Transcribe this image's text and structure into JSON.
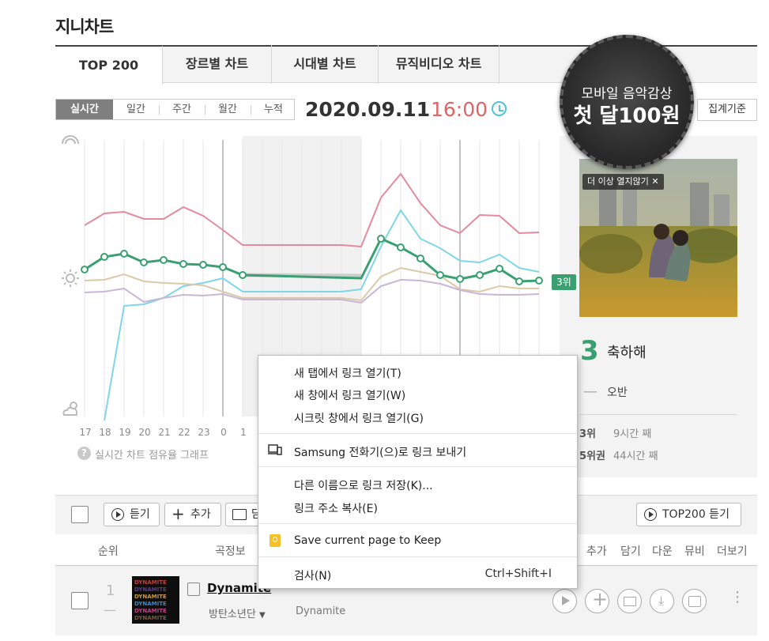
{
  "page": {
    "title": "지니차트"
  },
  "tabs": [
    {
      "label": "TOP 200",
      "active": true
    },
    {
      "label": "장르별 차트",
      "active": false
    },
    {
      "label": "시대별 차트",
      "active": false
    },
    {
      "label": "뮤직비디오 차트",
      "active": false
    }
  ],
  "period": {
    "items": [
      "실시간",
      "일간",
      "주간",
      "월간",
      "누적"
    ],
    "selected": "실시간"
  },
  "datetime": {
    "date": "2020.09.11",
    "time": "16:00"
  },
  "criteria_button": "집계기준",
  "promo": {
    "line1": "모바일 음악감상",
    "line2": "첫 달100원"
  },
  "chart": {
    "x_labels": [
      "17",
      "18",
      "19",
      "20",
      "21",
      "22",
      "23",
      "0",
      "1"
    ],
    "help_text": "실시간 차트 점유율 그래프",
    "rank_bubble": "3위",
    "colors": {
      "green": "#3aa071",
      "pink": "#e48a9c",
      "cyan": "#7fd6e8",
      "beige": "#dcc9a8",
      "purple": "#c8b6d6",
      "grey": "#cccccc"
    }
  },
  "side": {
    "ad_chip": "더 이상 열지않기",
    "rank": "3",
    "song": "축하해",
    "dash": "—",
    "artist": "오반",
    "stat1_rank": "3위",
    "stat1_text": "9시간 째",
    "stat2_rank": "5위권",
    "stat2_text": "44시간 째"
  },
  "toolbar": {
    "listen": "듣기",
    "add": "추가",
    "folder": "담",
    "top200_listen": "TOP200 듣기"
  },
  "columns": {
    "rank": "순위",
    "song_info": "곡정보",
    "add": "추가",
    "keep": "담기",
    "download": "다운",
    "mv": "뮤비",
    "more": "더보기"
  },
  "song_row": {
    "rank": "1",
    "change": "—",
    "title": "Dynamite",
    "artist": "방탄소년단",
    "album": "Dynamite"
  },
  "context_menu": {
    "open_new_tab": "새 탭에서 링크 열기(T)",
    "open_new_window": "새 창에서 링크 열기(W)",
    "open_incognito": "시크릿 창에서 링크 열기(G)",
    "send_to_device": "Samsung 전화기(으)로 링크 보내기",
    "save_link_as": "다른 이름으로 링크 저장(K)...",
    "copy_link": "링크 주소 복사(E)",
    "keep": "Save current page to Keep",
    "inspect": "검사(N)",
    "inspect_shortcut": "Ctrl+Shift+I"
  }
}
